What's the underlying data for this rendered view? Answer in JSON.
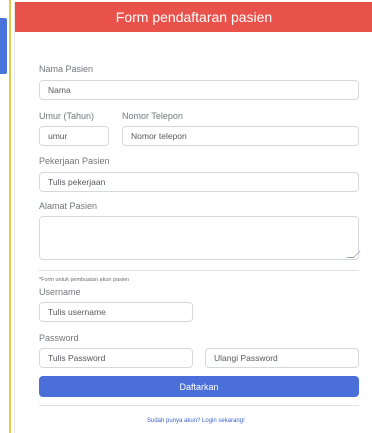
{
  "form": {
    "title": "Form pendaftaran pasien",
    "name": {
      "label": "Nama Pasien",
      "value": "Nama"
    },
    "age": {
      "label": "Umur (Tahun)",
      "value": "umur"
    },
    "phone": {
      "label": "Nomor Telepon",
      "value": "Nomor telepon"
    },
    "job": {
      "label": "Pekerjaan Pasien",
      "value": "Tulis pekerjaan"
    },
    "address": {
      "label": "Alamat Pasien",
      "value": ""
    },
    "account_note": "*Form untuk pembuatan akun pasien",
    "username": {
      "label": "Username",
      "value": "Tulis username"
    },
    "password": {
      "label": "Password",
      "value": "Tulis Password"
    },
    "password_repeat": {
      "value": "Ulangi Password"
    },
    "submit_label": "Daftarkan",
    "login_link": "Sudah punya akun? Login sekarang!"
  },
  "colors": {
    "header": "#e8524a",
    "button": "#4a6fd8",
    "side_accent": "#4a73d9",
    "side_line": "#e4c94a"
  }
}
